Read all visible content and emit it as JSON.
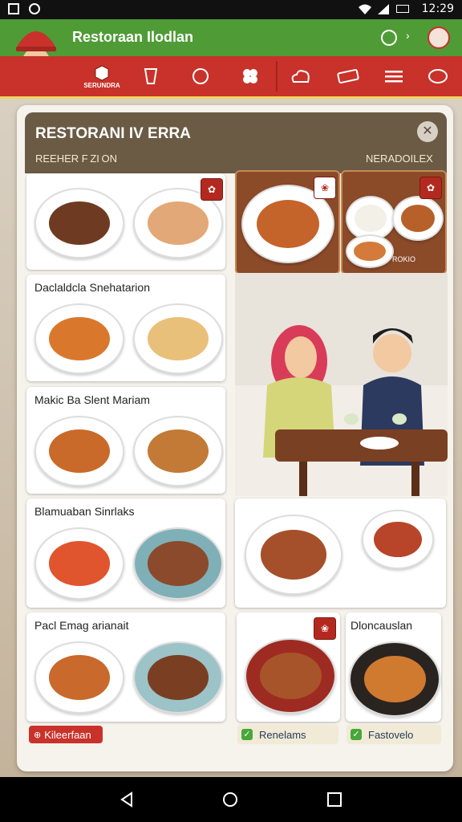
{
  "status_bar": {
    "time": "12:29"
  },
  "app_bar": {
    "title": "Restoraan Ilodlan"
  },
  "nav": {
    "item1_label": "SERUNDRA"
  },
  "card": {
    "title": "RESTORANI IV ERRA",
    "label_left": "REEHER F ZI ON",
    "label_right": "NERADOILEX",
    "tiles": [
      {
        "label": ""
      },
      {
        "label": "Daclaldcla Snehatarion"
      },
      {
        "label": "Makic Ba Slent Mariam"
      },
      {
        "label": "Blamuaban Sinrlaks"
      },
      {
        "label": "Pacl Emag arianait"
      }
    ],
    "right_tile_label": "Dloncauslan",
    "panel_small_label": "ROKIO"
  },
  "footer": {
    "left_pill": "Kileerfaan",
    "mid_pill": "Renelams",
    "right_pill": "Fastovelo"
  },
  "colors": {
    "appbar": "#4f9b35",
    "navbar": "#c8322a",
    "card_header": "#6b5b45",
    "accent_gold": "#f1d35c"
  }
}
